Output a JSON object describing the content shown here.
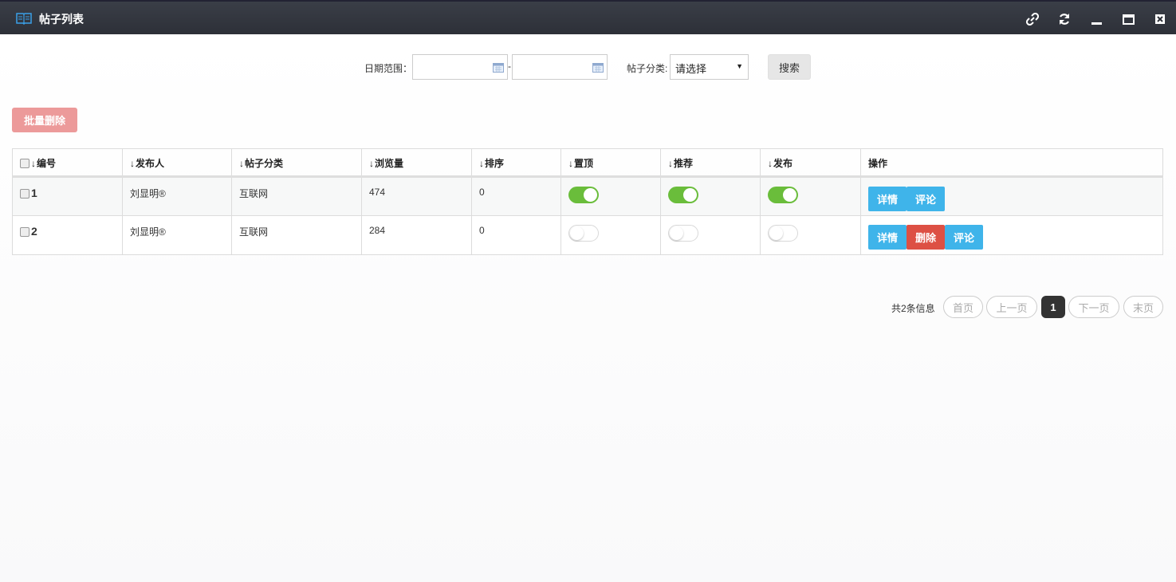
{
  "window": {
    "title": "帖子列表",
    "title_icon": "book-icon",
    "controls": [
      "link-icon",
      "refresh-icon",
      "minimize-icon",
      "maximize-icon",
      "close-icon"
    ]
  },
  "search": {
    "date_label": "日期范围：",
    "date_start": "",
    "date_end": "",
    "date_separator": "-",
    "category_label": "帖子分类:",
    "category_selected": "请选择",
    "search_button": "搜索"
  },
  "toolbar": {
    "batch_delete": "批量删除"
  },
  "table": {
    "headers": [
      "编号",
      "发布人",
      "帖子分类",
      "浏览量",
      "排序",
      "置顶",
      "推荐",
      "发布",
      "操作"
    ],
    "rows": [
      {
        "id": "1",
        "publisher": "刘显明®",
        "category": "互联网",
        "views": "474",
        "order": "0",
        "pinned": true,
        "recommended": true,
        "published": true,
        "actions": [
          "详情",
          "评论"
        ]
      },
      {
        "id": "2",
        "publisher": "刘显明®",
        "category": "互联网",
        "views": "284",
        "order": "0",
        "pinned": false,
        "recommended": false,
        "published": false,
        "actions": [
          "详情",
          "删除",
          "评论"
        ]
      }
    ]
  },
  "pager": {
    "info": "共2条信息",
    "first": "首页",
    "prev": "上一页",
    "current": "1",
    "next": "下一页",
    "last": "末页"
  },
  "colors": {
    "titlebar": "#2f323a",
    "switch_on": "#6abd3b",
    "btn_blue": "#3fb4ea",
    "btn_red": "#dd5044",
    "batch_delete": "#ec9a9a"
  }
}
